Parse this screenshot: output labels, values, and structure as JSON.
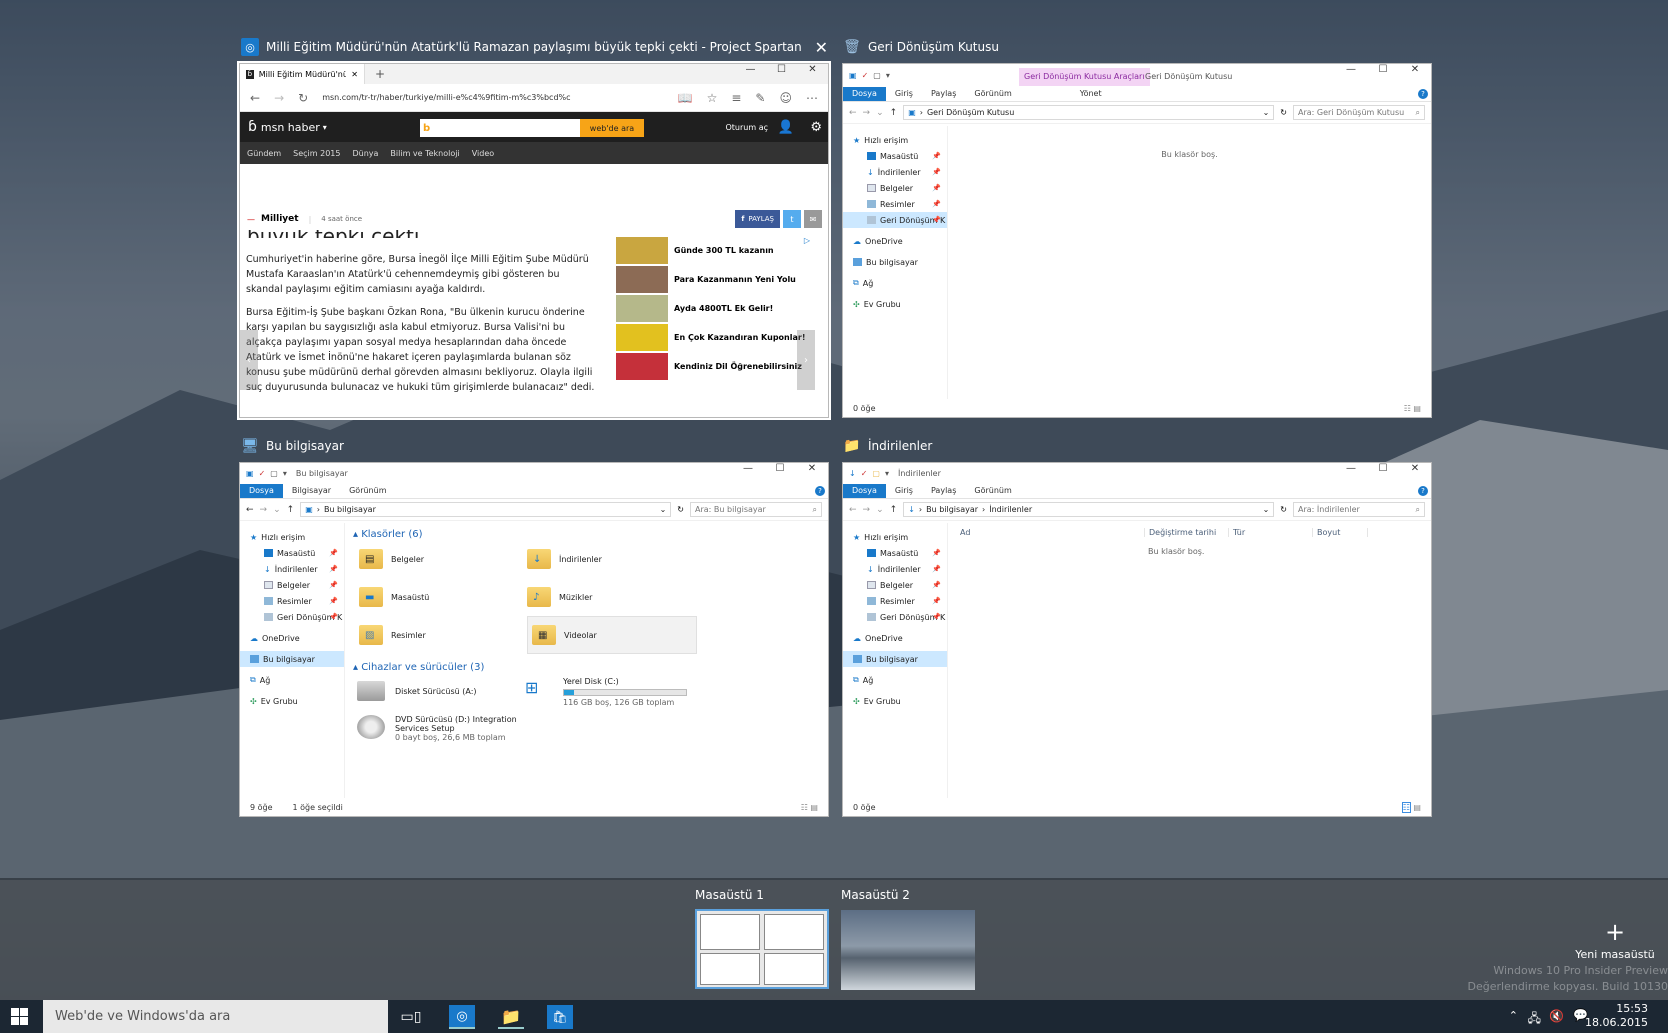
{
  "windows": {
    "browser": {
      "title": "Milli Eğitim Müdürü'nün Atatürk'lü Ramazan paylaşımı büyük tepki çekti - Project Spartan",
      "tab_label": "Milli Eğitim Müdürü'nün A",
      "url": "msn.com/tr-tr/haber/turkiye/milli-e%c4%9fitim-m%c3%bcd%c",
      "brand": "msn haber",
      "search_button": "web'de ara",
      "signin": "Oturum aç",
      "nav": [
        "Gündem",
        "Seçim 2015",
        "Dünya",
        "Bilim ve Teknoloji",
        "Video"
      ],
      "headline_fragment": "büyük tepki çekti",
      "source": "Milliyet",
      "time": "4 saat önce",
      "share": "PAYLAŞ",
      "paragraph1": "Cumhuriyet'in haberine göre, Bursa İnegöl İlçe Milli Eğitim Şube Müdürü Mustafa Karaaslan'ın Atatürk'ü cehennemdeymiş gibi gösteren bu skandal paylaşımı eğitim camiasını ayağa kaldırdı.",
      "paragraph2": "Bursa Eğitim-İş Şube başkanı Özkan Rona, \"Bu ülkenin kurucu önderine karşı yapılan bu saygısızlığı asla kabul etmiyoruz. Bursa Valisi'ni bu alçakça paylaşımı yapan sosyal medya hesaplarından daha öncede Atatürk ve İsmet İnönü'ne hakaret içeren paylaşımlarda bulanan söz konusu şube müdürünü derhal görevden almasını bekliyoruz. Olayla ilgili suç duyurusunda bulunacaz ve hukuki tüm girişimlerde bulanacaız\" dedi.",
      "ads": [
        "Günde 300 TL kazanın",
        "Para Kazanmanın Yeni Yolu",
        "Ayda 4800TL Ek Gelir!",
        "En Çok Kazandıran Kuponlar!",
        "Kendiniz Dil Öğrenebilirsiniz"
      ]
    },
    "recycle": {
      "title": "Geri Dönüşüm Kutusu",
      "tools_tab": "Geri Dönüşüm Kutusu Araçları",
      "tools_sub": "Yönet",
      "qbar_title": "Geri Dönüşüm Kutusu",
      "tabs": [
        "Dosya",
        "Giriş",
        "Paylaş",
        "Görünüm"
      ],
      "path": "Geri Dönüşüm Kutusu",
      "search": "Ara: Geri Dönüşüm Kutusu",
      "empty": "Bu klasör boş.",
      "status": "0 öğe"
    },
    "thispc": {
      "title": "Bu bilgisayar",
      "tabs": [
        "Dosya",
        "Bilgisayar",
        "Görünüm"
      ],
      "path": "Bu bilgisayar",
      "search": "Ara: Bu bilgisayar",
      "folders_header": "Klasörler (6)",
      "folders": [
        "Belgeler",
        "İndirilenler",
        "Masaüstü",
        "Müzikler",
        "Resimler",
        "Videolar"
      ],
      "devices_header": "Cihazlar ve sürücüler (3)",
      "drive_a": "Disket Sürücüsü (A:)",
      "drive_c": "Yerel Disk (C:)",
      "drive_c_info": "116 GB boş, 126 GB toplam",
      "drive_c_used": 0.08,
      "drive_d": "DVD Sürücüsü (D:) Integration Services Setup",
      "drive_d_info": "0 bayt boş, 26,6 MB toplam",
      "status_count": "9 öğe",
      "status_sel": "1 öğe seçildi"
    },
    "downloads": {
      "title": "İndirilenler",
      "tabs": [
        "Dosya",
        "Giriş",
        "Paylaş",
        "Görünüm"
      ],
      "path_root": "Bu bilgisayar",
      "path_leaf": "İndirilenler",
      "search": "Ara: İndirilenler",
      "columns": [
        "Ad",
        "Değiştirme tarihi",
        "Tür",
        "Boyut"
      ],
      "empty": "Bu klasör boş.",
      "status": "0 öğe"
    }
  },
  "nav_pane": {
    "quick": "Hızlı erişim",
    "items": [
      "Masaüstü",
      "İndirilenler",
      "Belgeler",
      "Resimler",
      "Geri Dönüşüm K"
    ],
    "onedrive": "OneDrive",
    "pc": "Bu bilgisayar",
    "network": "Ağ",
    "homegroup": "Ev Grubu"
  },
  "desktops": {
    "d1": "Masaüstü 1",
    "d2": "Masaüstü 2",
    "new": "Yeni masaüstü"
  },
  "taskbar": {
    "search_placeholder": "Web'de ve Windows'da ara",
    "time": "15:53",
    "date": "18.06.2015"
  },
  "watermark": {
    "line1": "Windows 10 Pro Insider Preview",
    "line2": "Değerlendirme kopyası. Build 10130"
  },
  "colors": {
    "accent": "#1979ca",
    "taskbar": "#1c2733",
    "msn_search": "#f7a417"
  }
}
